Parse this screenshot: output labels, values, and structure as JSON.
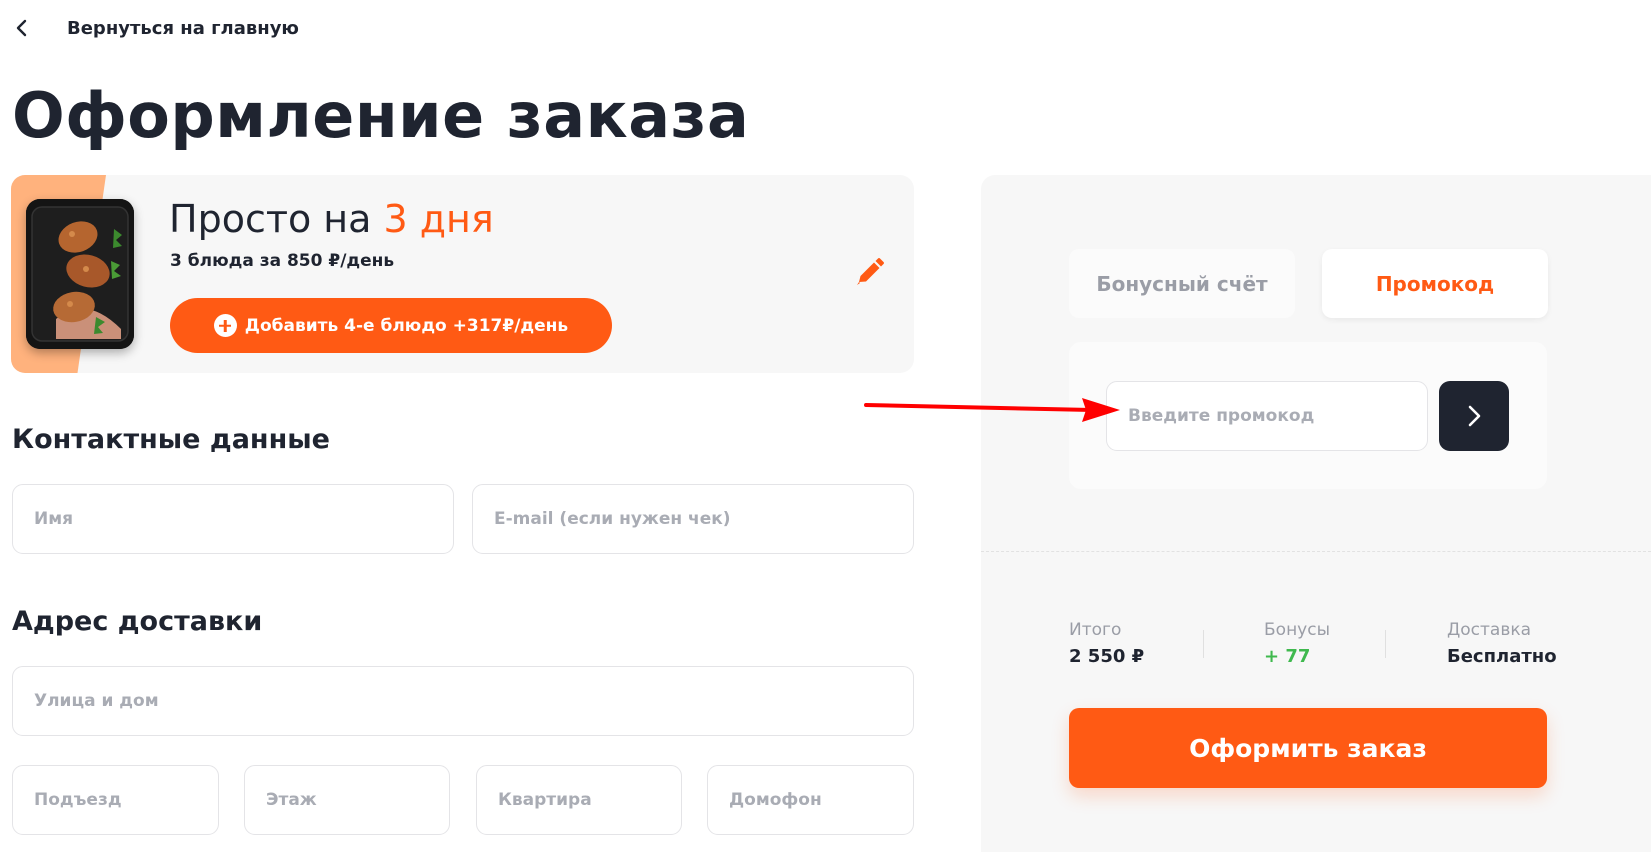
{
  "nav": {
    "back_label": "Вернуться на главную",
    "back_icon": "chevron-left-icon"
  },
  "page": {
    "title": "Оформление заказа"
  },
  "plan": {
    "title_prefix": "Просто на ",
    "title_accent": "3 дня",
    "subtitle": "3 блюда за 850 ₽/день",
    "add_button_label": "Добавить 4-е блюдо +317₽/день",
    "add_icon": "plus-circle-icon",
    "edit_icon": "pencil-icon"
  },
  "contacts": {
    "heading": "Контактные данные",
    "name_placeholder": "Имя",
    "email_placeholder": "E-mail (если нужен чек)"
  },
  "address": {
    "heading": "Адрес доставки",
    "street_placeholder": "Улица и дом",
    "entrance_placeholder": "Подъезд",
    "floor_placeholder": "Этаж",
    "apartment_placeholder": "Квартира",
    "intercom_placeholder": "Домофон"
  },
  "discount": {
    "tabs": [
      {
        "label": "Бонусный счёт",
        "active": false
      },
      {
        "label": "Промокод",
        "active": true
      }
    ],
    "promo_placeholder": "Введите промокод",
    "submit_icon": "chevron-right-icon"
  },
  "summary": {
    "total_label": "Итого",
    "total_value": "2 550 ₽",
    "bonus_label": "Бонусы",
    "bonus_value": "+ 77",
    "delivery_label": "Доставка",
    "delivery_value": "Бесплатно"
  },
  "order_button_label": "Оформить заказ",
  "colors": {
    "accent": "#ff5a14",
    "dark": "#1f2430",
    "bonus_green": "#3fb94e",
    "annotation_arrow": "#ff0000"
  }
}
